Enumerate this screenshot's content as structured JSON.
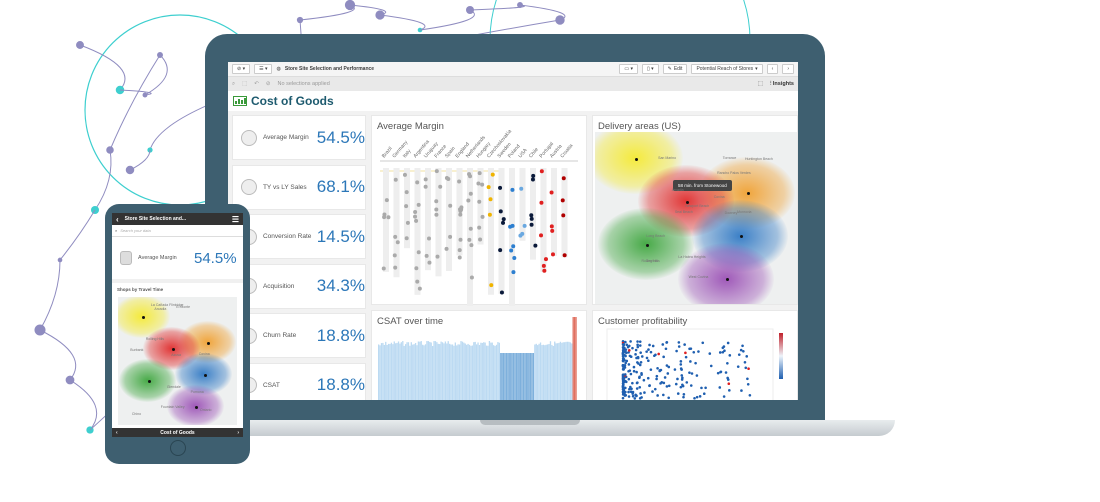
{
  "laptop": {
    "toolbar": {
      "app_title": "Store Site Selection and Performance",
      "edit_label": "Edit",
      "sheet_name": "Potential Reach of Stores",
      "prev_icon": "chevron-left",
      "next_icon": "chevron-right"
    },
    "selection_bar": {
      "status": "No selections applied",
      "insights_label": "Insights"
    },
    "sheet_title": "Cost of Goods",
    "kpis": [
      {
        "label": "Average Margin",
        "value": "54.5%"
      },
      {
        "label": "TY vs LY Sales",
        "value": "68.1%"
      },
      {
        "label": "Conversion Rate",
        "value": "14.5%"
      },
      {
        "label": "Acquisition",
        "value": "34.3%"
      },
      {
        "label": "Churn Rate",
        "value": "18.8%"
      },
      {
        "label": "CSAT",
        "value": "18.8%"
      }
    ],
    "avg_margin": {
      "title": "Average Margin",
      "countries": [
        "Brazil",
        "Germany",
        "Italy",
        "Argentina",
        "Uruguay",
        "France",
        "Spain",
        "England",
        "Netherlands",
        "Hungary",
        "Czechoslovakia",
        "Sweden",
        "Poland",
        "USA",
        "Chile",
        "Portugal",
        "Austria",
        "Croatia"
      ]
    },
    "delivery": {
      "title": "Delivery areas (US)",
      "tooltip": "58 min. from Stonewood",
      "places": [
        "San Marino",
        "Arcadia",
        "Monrovia",
        "West Covina",
        "Covina",
        "Downey",
        "Cerritos",
        "Long Beach",
        "Seal Beach",
        "Huntington Beach",
        "Newport Beach",
        "Rolling Hills",
        "Rancho Palos Verdes",
        "Torrance",
        "La Habra Heights"
      ]
    },
    "csat": {
      "title": "CSAT over time"
    },
    "profitability": {
      "title": "Customer profitability"
    }
  },
  "phone": {
    "header_title": "Store Site Selection and...",
    "search_placeholder": "Search your data",
    "kpi": {
      "label": "Average Margin",
      "value": "54.5%"
    },
    "map_title": "Shops by Travel Time",
    "places": [
      "Burbank",
      "La Cañada Flintridge",
      "Glendale",
      "Arcadia",
      "Azusa",
      "El Monte",
      "Covina",
      "Pomona",
      "Chino",
      "Ontario",
      "Rolling Hills",
      "Fountain Valley"
    ],
    "footer_title": "Cost of Goods"
  },
  "colors": {
    "bezel": "#3e5f70",
    "accent": "#2c77b8",
    "title": "#1d5a6e",
    "network_teal": "#3ecfcf",
    "network_purple": "#8f8cc0"
  }
}
